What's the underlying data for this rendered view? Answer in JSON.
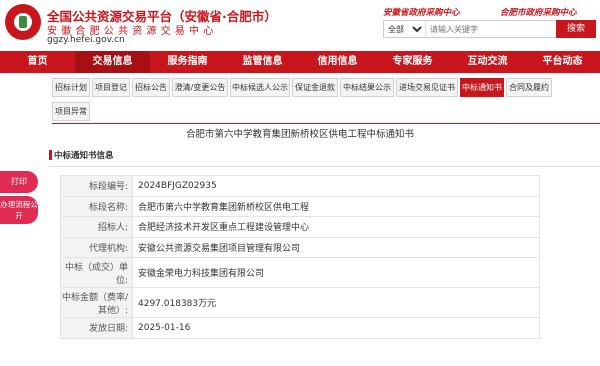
{
  "header": {
    "title": "全国公共资源交易平台（安徽省·合肥市）",
    "subtitle": "安徽合肥公共资源交易中心",
    "url": "ggzy.hefei.gov.cn",
    "slogan_left": "安徽省政府采购中心",
    "slogan_right": "合肥市政府采购中心",
    "search_scope": "全部",
    "search_placeholder": "请输入关键字",
    "search_button": "搜索"
  },
  "nav": [
    "首页",
    "交易信息",
    "服务指南",
    "监管信息",
    "信用信息",
    "专家服务",
    "互动交流",
    "平台动态"
  ],
  "nav_active": "交易信息",
  "tabs": [
    "招标计划",
    "项目登记",
    "招标公告",
    "澄清/变更公告",
    "中标候选人公示",
    "保证金退款",
    "中标结果公示",
    "进场交易见证书",
    "中标通知书",
    "合同及履约",
    "项目异常"
  ],
  "tabs_active": "中标通知书",
  "notice_title": "合肥市第六中学教育集团新桥校区供电工程中标通知书",
  "section_title": "中标通知书信息",
  "side": {
    "print": "打印",
    "process": "办理流程公开"
  },
  "rows": [
    {
      "label": "标段编号:",
      "value": "2024BFJGZ02935"
    },
    {
      "label": "标段名称:",
      "value": "合肥市第六中学教育集团新桥校区供电工程"
    },
    {
      "label": "招标人:",
      "value": "合肥经济技术开发区重点工程建设管理中心"
    },
    {
      "label": "代理机构:",
      "value": "安徽公共资源交易集团项目管理有限公司"
    },
    {
      "label": "中标（成交）单位:",
      "value": "安徽金荣电力科技集团有限公司"
    },
    {
      "label": "中标金额（费率/其他）:",
      "value": "4297.018383万元"
    },
    {
      "label": "发放日期:",
      "value": "2025-01-16"
    }
  ],
  "colors": {
    "brand": "#c9161d",
    "side": "#e22b53"
  }
}
